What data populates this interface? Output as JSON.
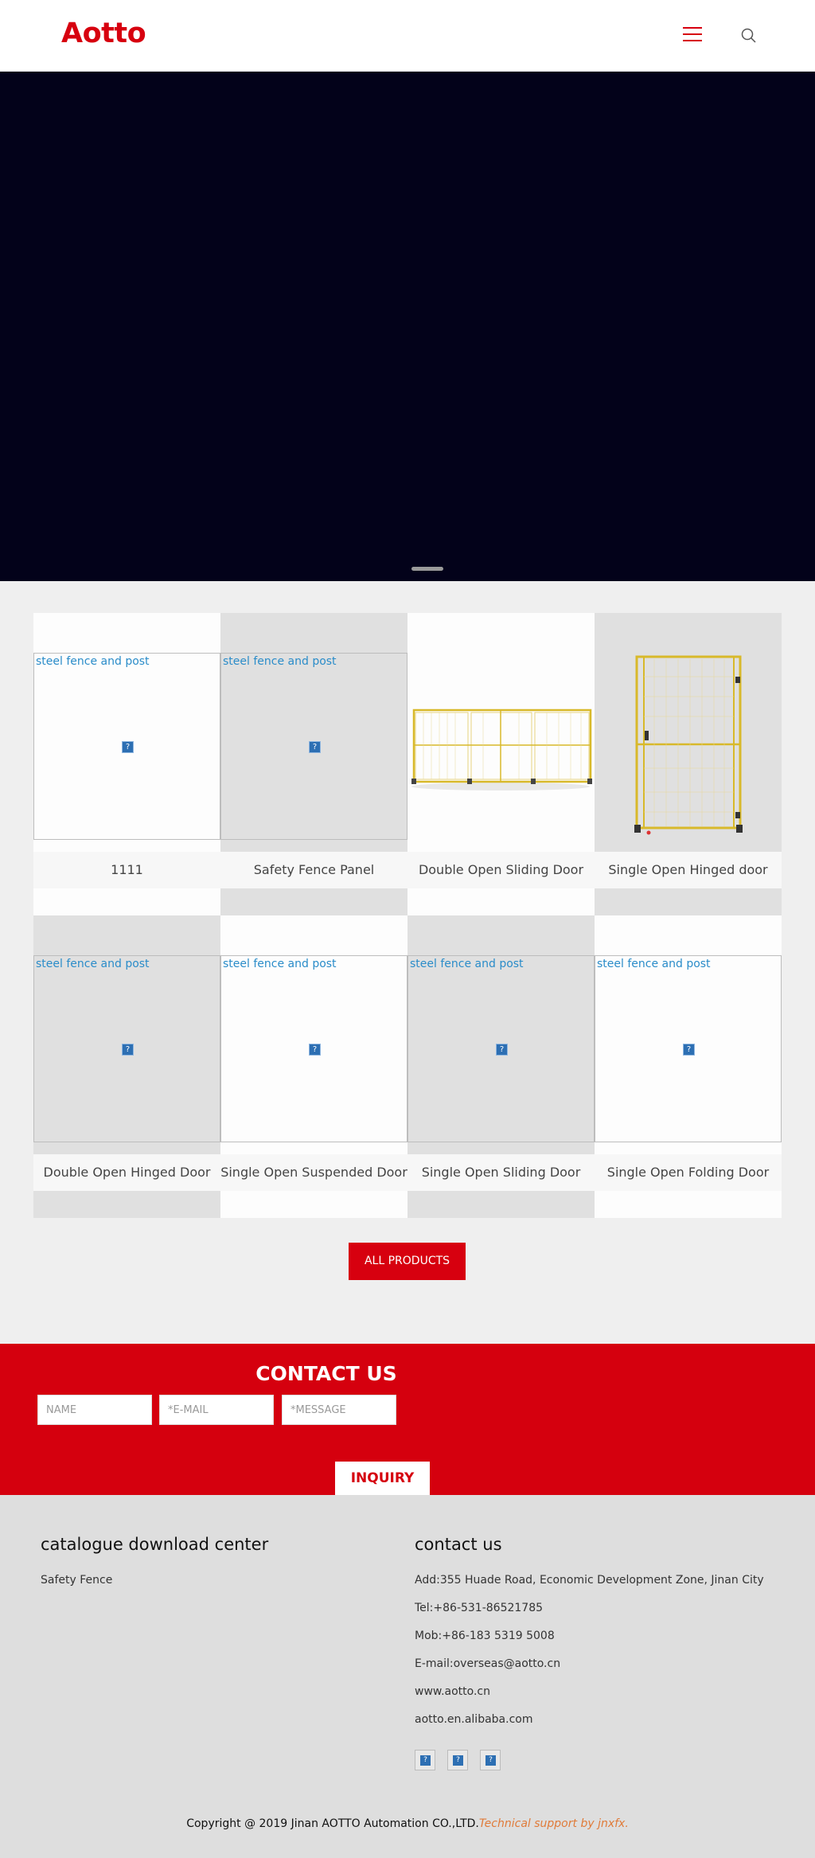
{
  "header": {
    "logo": "Aotto"
  },
  "products": [
    {
      "name": "1111",
      "alt": "steel fence and post"
    },
    {
      "name": "Safety Fence Panel",
      "alt": "steel fence and post"
    },
    {
      "name": "Double Open Sliding Door",
      "alt": ""
    },
    {
      "name": "Single Open Hinged door",
      "alt": ""
    },
    {
      "name": "Double Open Hinged Door",
      "alt": "steel fence and post"
    },
    {
      "name": "Single Open Suspended Door",
      "alt": "steel fence and post"
    },
    {
      "name": "Single Open Sliding Door",
      "alt": "steel fence and post"
    },
    {
      "name": "Single Open Folding Door",
      "alt": "steel fence and post"
    }
  ],
  "all_products_label": "ALL PRODUCTS",
  "contact": {
    "title": "CONTACT US",
    "name_placeholder": "NAME",
    "email_placeholder": "*E-MAIL",
    "message_placeholder": "*MESSAGE",
    "inquiry_label": "INQUIRY"
  },
  "footer": {
    "catalogue_title": "catalogue download center",
    "catalogue_item": "Safety Fence",
    "contact_title": "contact us",
    "address": "Add:355 Huade Road, Economic Development Zone, Jinan City",
    "tel": "Tel:+86-531-86521785",
    "mob": "Mob:+86-183 5319 5008",
    "email": "E-mail:overseas@aotto.cn",
    "website": "www.aotto.cn",
    "alibaba": "aotto.en.alibaba.com",
    "copyright": "Copyright @ 2019 Jinan AOTTO Automation CO.,LTD.",
    "support": "Technical support by jnxfx."
  },
  "colors": {
    "brand": "#d7000f",
    "hero": "#03021a",
    "link": "#2a8cc9"
  }
}
